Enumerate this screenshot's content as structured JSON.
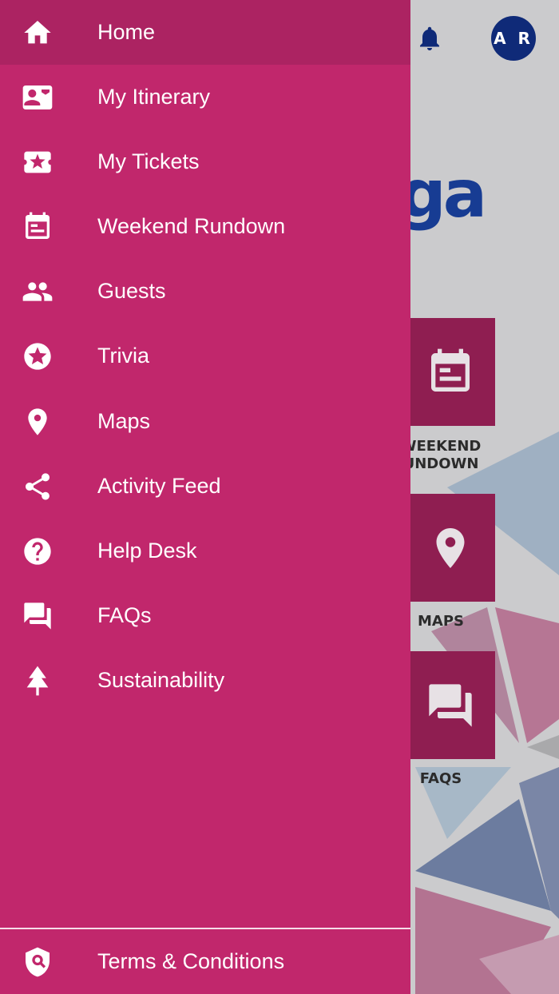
{
  "background": {
    "avatar_initials": "A R",
    "logo_fragment": "ga",
    "tiles": [
      {
        "icon": "calendar-icon",
        "label_line1": "WEEKEND",
        "label_line2": "UNDOWN"
      },
      {
        "icon": "map-pin-icon",
        "label_line1": "MAPS",
        "label_line2": ""
      },
      {
        "icon": "chat-icon",
        "label_line1": "FAQS",
        "label_line2": ""
      }
    ]
  },
  "drawer": {
    "items": [
      {
        "label": "Home",
        "icon": "home-icon",
        "active": true
      },
      {
        "label": "My Itinerary",
        "icon": "contact-card-icon"
      },
      {
        "label": "My Tickets",
        "icon": "ticket-icon"
      },
      {
        "label": "Weekend Rundown",
        "icon": "calendar-icon"
      },
      {
        "label": "Guests",
        "icon": "people-icon"
      },
      {
        "label": "Trivia",
        "icon": "star-circle-icon"
      },
      {
        "label": "Maps",
        "icon": "map-pin-icon"
      },
      {
        "label": "Activity Feed",
        "icon": "share-icon"
      },
      {
        "label": "Help Desk",
        "icon": "help-circle-icon"
      },
      {
        "label": "FAQs",
        "icon": "chat-icon"
      },
      {
        "label": "Sustainability",
        "icon": "tree-icon"
      }
    ],
    "footer_item": {
      "label": "Terms & Conditions",
      "icon": "shield-search-icon"
    }
  },
  "colors": {
    "drawer_bg": "#c1276c",
    "drawer_active": "#ac2362",
    "tile_bg": "#8f1e51",
    "avatar_bg": "#0f2a78",
    "logo": "#173c93"
  }
}
